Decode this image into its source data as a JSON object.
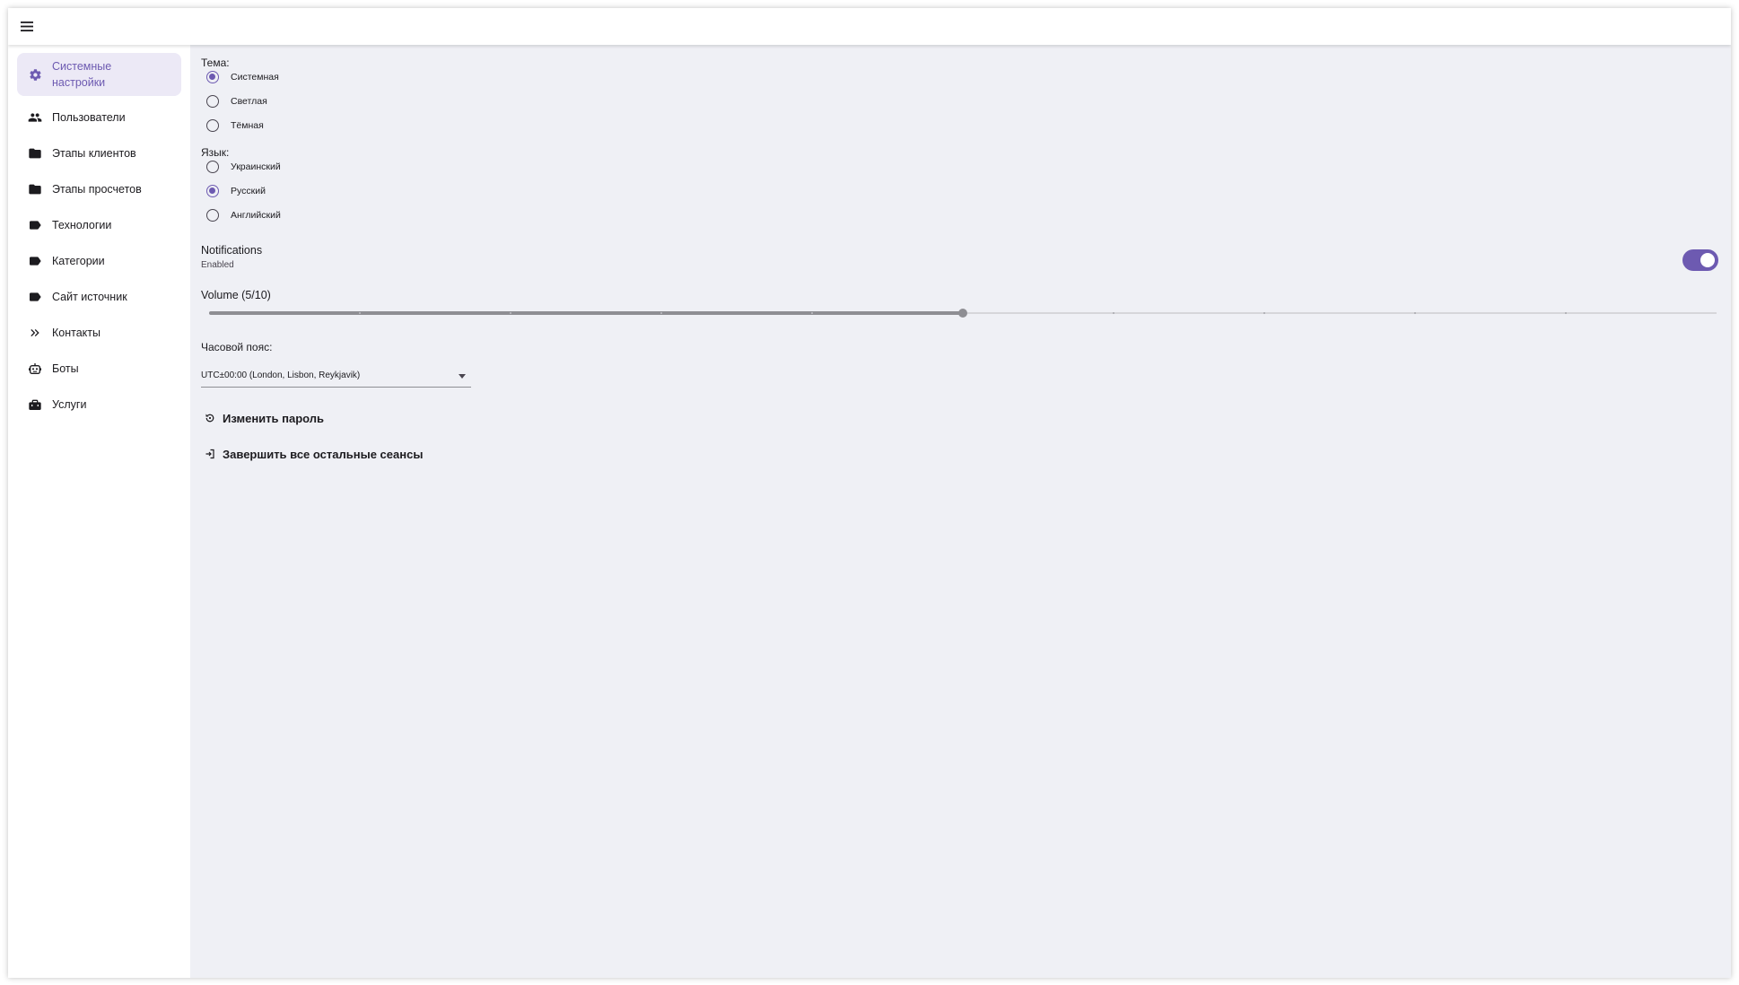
{
  "appbar": {
    "menu_icon": "hamburger-menu-icon"
  },
  "sidebar": {
    "items": [
      {
        "label": "Системные настройки",
        "icon": "gear-icon",
        "active": true
      },
      {
        "label": "Пользователи",
        "icon": "people-icon"
      },
      {
        "label": "Этапы клиентов",
        "icon": "folder-icon"
      },
      {
        "label": "Этапы просчетов",
        "icon": "folder-icon"
      },
      {
        "label": "Технологии",
        "icon": "label-tag-icon"
      },
      {
        "label": "Категории",
        "icon": "label-tag-icon"
      },
      {
        "label": "Сайт источник",
        "icon": "label-tag-icon"
      },
      {
        "label": "Контакты",
        "icon": "double-chevron-right-icon"
      },
      {
        "label": "Боты",
        "icon": "robot-icon"
      },
      {
        "label": "Услуги",
        "icon": "toolbox-icon"
      }
    ]
  },
  "theme": {
    "title": "Тема:",
    "options": [
      {
        "label": "Системная",
        "checked": true
      },
      {
        "label": "Светлая",
        "checked": false
      },
      {
        "label": "Тёмная",
        "checked": false
      }
    ]
  },
  "language": {
    "title": "Язык:",
    "options": [
      {
        "label": "Украинский",
        "checked": false
      },
      {
        "label": "Русский",
        "checked": true
      },
      {
        "label": "Английский",
        "checked": false
      }
    ]
  },
  "notifications": {
    "title": "Notifications",
    "status": "Enabled",
    "enabled": true
  },
  "volume": {
    "title": "Volume (5/10)",
    "value": 5,
    "max": 10
  },
  "timezone": {
    "label": "Часовой пояс:",
    "value": "UTC±00:00 (London, Lisbon, Reykjavik)"
  },
  "actions": {
    "change_password": {
      "label": "Изменить пароль",
      "icon": "password-reset-icon"
    },
    "end_sessions": {
      "label": "Завершить все остальные сеансы",
      "icon": "logout-icon"
    }
  },
  "colors": {
    "accent": "#6d5ab1",
    "active_bg": "#ece9f6",
    "main_bg": "#eff0f5"
  }
}
